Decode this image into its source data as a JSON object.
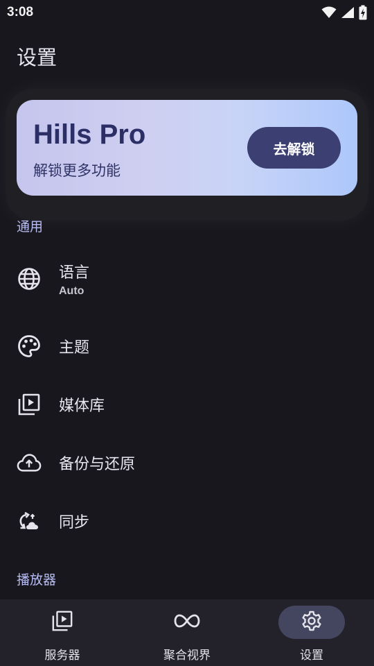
{
  "status_bar": {
    "time": "3:08"
  },
  "page": {
    "title": "设置"
  },
  "pro_card": {
    "title": "Hills Pro",
    "subtitle": "解锁更多功能",
    "button_label": "去解锁"
  },
  "sections": {
    "general": "通用",
    "player": "播放器"
  },
  "settings": {
    "language": {
      "label": "语言",
      "value": "Auto",
      "icon": "globe-icon"
    },
    "theme": {
      "label": "主题",
      "icon": "palette-icon"
    },
    "media_library": {
      "label": "媒体库",
      "icon": "video-library-icon"
    },
    "backup": {
      "label": "备份与还原",
      "icon": "cloud-upload-icon"
    },
    "sync": {
      "label": "同步",
      "icon": "sync-cloud-icon"
    }
  },
  "bottom_nav": {
    "servers": "服务器",
    "aggregate": "聚合视界",
    "settings": "设置",
    "active": "settings"
  },
  "colors": {
    "background": "#18171d",
    "accent": "#b9bdf5",
    "pro_button": "#3b3f71",
    "nav_active_pill": "#43465e"
  }
}
